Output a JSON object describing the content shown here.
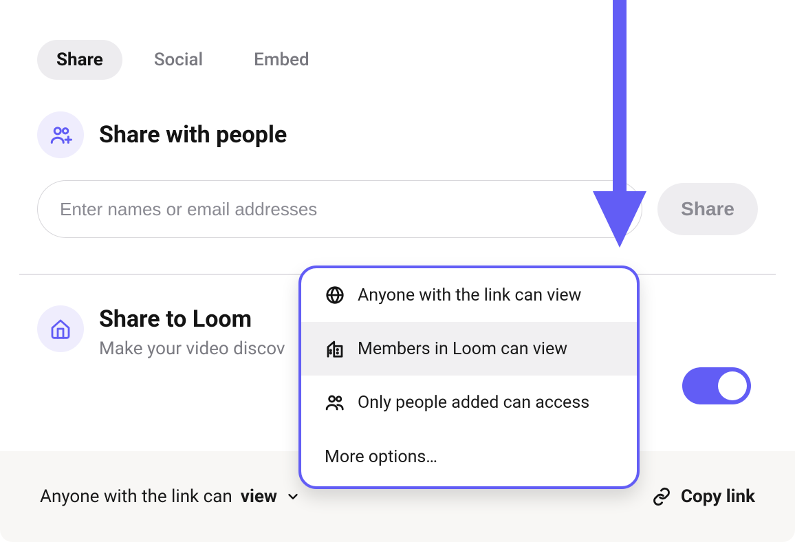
{
  "tabs": {
    "active": "Share",
    "items": [
      "Share",
      "Social",
      "Embed"
    ]
  },
  "shareWith": {
    "title": "Share with people",
    "placeholder": "Enter names or email addresses",
    "shareButton": "Share"
  },
  "shareToLoom": {
    "title": "Share to Loom",
    "subtitle": "Make your video discov",
    "toggleOn": true
  },
  "bottom": {
    "summaryPrefix": "Anyone with the link can ",
    "summaryBold": "view",
    "copyLink": "Copy link"
  },
  "popover": {
    "options": [
      "Anyone with the link can view",
      "Members in Loom can view",
      "Only people added can access"
    ],
    "more": "More options…",
    "hoveredIndex": 1
  },
  "colors": {
    "accent": "#625df5"
  }
}
